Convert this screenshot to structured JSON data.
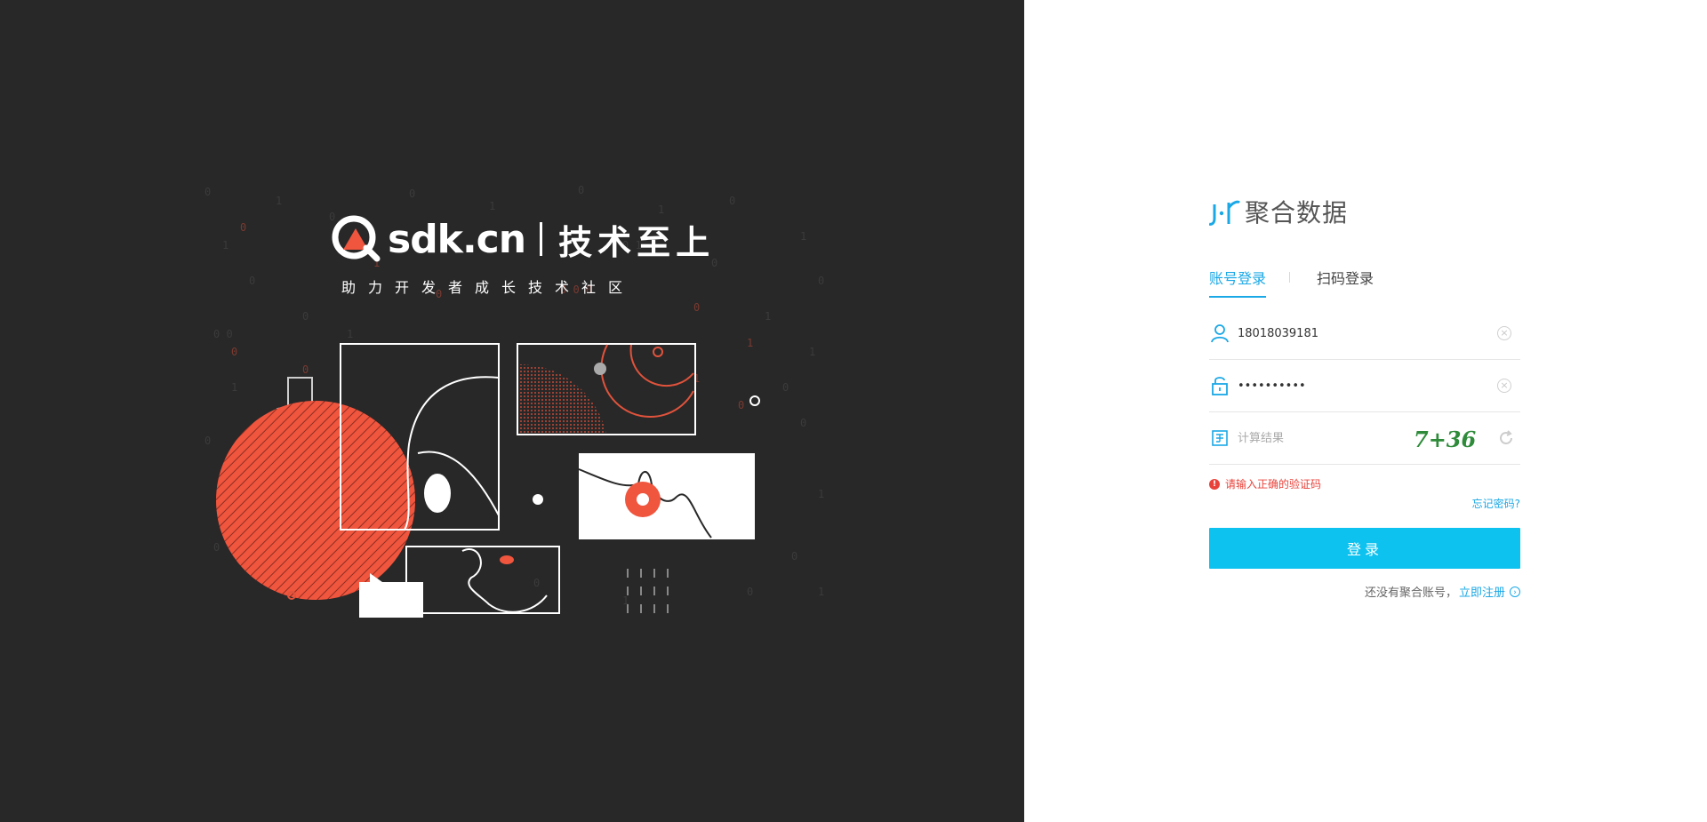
{
  "illustration": {
    "brand_name": "sdk.cn",
    "slogan": "技术至上",
    "subtitle": "助力开发者成长技术社区",
    "accent_color": "#f0553e",
    "background_color": "#282828"
  },
  "login": {
    "logo_text": "聚合数据",
    "tabs": [
      {
        "label": "账号登录",
        "active": true
      },
      {
        "label": "扫码登录",
        "active": false
      }
    ],
    "username": {
      "value": "18018039181",
      "icon": "user-icon"
    },
    "password": {
      "value": "••••••••••",
      "icon": "lock-icon"
    },
    "captcha": {
      "placeholder": "计算结果",
      "image_text": "7+36",
      "icon": "keypad-icon"
    },
    "error_message": "请输入正确的验证码",
    "forgot_password": "忘记密码?",
    "submit_label": "登录",
    "register_prompt": "还没有聚合账号，",
    "register_link": "立即注册",
    "accent_color": "#0ec2f0"
  }
}
